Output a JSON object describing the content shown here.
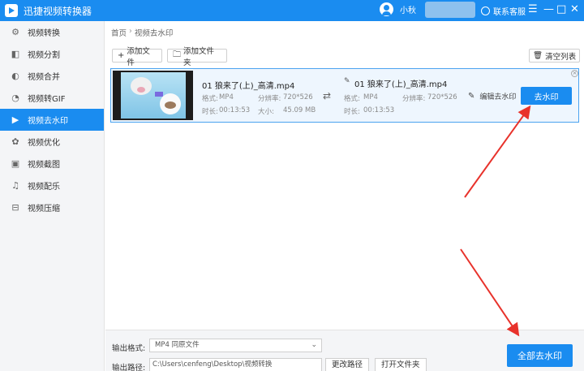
{
  "app": {
    "title": "迅捷视频转换器",
    "username": "小秋",
    "support": "联系客服"
  },
  "window_controls": {
    "menu": "☰",
    "minimize": "—",
    "maximize": "□",
    "close": "✕"
  },
  "sidebar": {
    "items": [
      {
        "label": "视频转换",
        "icon": "video-convert-icon"
      },
      {
        "label": "视频分割",
        "icon": "video-split-icon"
      },
      {
        "label": "视频合并",
        "icon": "video-merge-icon"
      },
      {
        "label": "视频转GIF",
        "icon": "gif-icon"
      },
      {
        "label": "视频去水印",
        "icon": "play-circle-icon",
        "active": true
      },
      {
        "label": "视频优化",
        "icon": "optimize-icon"
      },
      {
        "label": "视频截图",
        "icon": "screenshot-icon"
      },
      {
        "label": "视频配乐",
        "icon": "music-icon"
      },
      {
        "label": "视频压缩",
        "icon": "compress-icon"
      }
    ]
  },
  "breadcrumb": {
    "home": "首页",
    "sep": "›",
    "current": "视频去水印"
  },
  "toolbar": {
    "add_file": "添加文件",
    "add_folder": "添加文件夹",
    "clear_list": "清空列表"
  },
  "file": {
    "source_name": "01 狼来了(上)_高清.mp4",
    "output_name": "01 狼来了(上)_高清.mp4",
    "format_label": "格式:",
    "format_value": "MP4",
    "resolution_label": "分辨率:",
    "resolution_value": "720*526",
    "duration_label": "时长:",
    "duration_value": "00:13:53",
    "size_label": "大小:",
    "size_value": "45.09 MB",
    "edit_watermark": "编辑去水印",
    "remove_watermark": "去水印"
  },
  "bottom": {
    "output_format_label": "输出格式:",
    "output_format_value": "MP4  同原文件",
    "output_path_label": "输出路径:",
    "output_path_value": "C:\\Users\\cenfeng\\Desktop\\视频转换",
    "change_path": "更改路径",
    "open_folder": "打开文件夹",
    "remove_all": "全部去水印"
  },
  "colors": {
    "accent": "#1a8cf0",
    "annotation_arrow": "#e8322b"
  }
}
